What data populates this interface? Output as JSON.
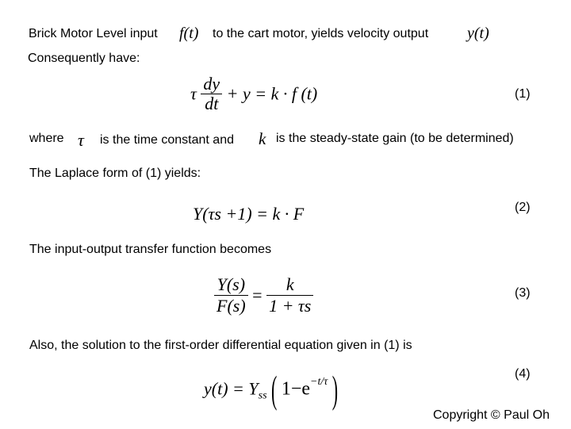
{
  "intro": {
    "text_before": "Brick Motor Level input",
    "input_symbol": "f(t)",
    "text_middle": "to the cart motor, yields velocity output",
    "output_symbol": "y(t)"
  },
  "consequently": "Consequently have:",
  "equation1": {
    "tau": "τ",
    "numerator": "dy",
    "denominator": "dt",
    "rest": "+ y = k · f (t)",
    "number": "(1)"
  },
  "where_line": {
    "where": "where",
    "tau": "τ",
    "time_constant_text": "is the time constant and",
    "k": "k",
    "gain_text": "is the steady-state gain (to be determined)"
  },
  "laplace_text": "The Laplace form of (1) yields:",
  "equation2": {
    "expression": "Y(τs +1) = k · F",
    "number": "(2)"
  },
  "transfer_text": "The input-output transfer function becomes",
  "equation3": {
    "lhs_numerator": "Y(s)",
    "lhs_denominator": "F(s)",
    "equals": "=",
    "rhs_numerator": "k",
    "rhs_denominator": "1 + τs",
    "number": "(3)"
  },
  "solution_text": "Also, the solution to the first-order differential equation given in (1) is",
  "equation4": {
    "lhs": "y(t) = Y",
    "subscript": "ss",
    "one_minus_e": "1−e",
    "exponent": "−t/τ",
    "number": "(4)"
  },
  "copyright": "Copyright © Paul Oh"
}
